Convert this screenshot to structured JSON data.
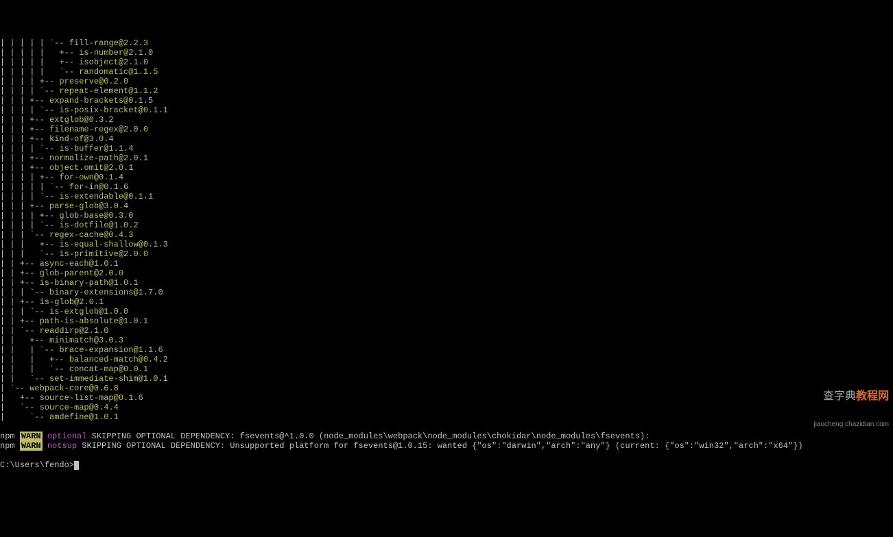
{
  "tree_lines": [
    {
      "prefix": "| | | | | `-- ",
      "pkg": "fill-range@2.2.3"
    },
    {
      "prefix": "| | | | |   +-- ",
      "pkg": "is-number@2.1.0"
    },
    {
      "prefix": "| | | | |   +-- ",
      "pkg": "isobject@2.1.0"
    },
    {
      "prefix": "| | | | |   `-- ",
      "pkg": "randomatic@1.1.5"
    },
    {
      "prefix": "| | | | +-- ",
      "pkg": "preserve@0.2.0"
    },
    {
      "prefix": "| | | | `-- ",
      "pkg": "repeat-element@1.1.2"
    },
    {
      "prefix": "| | | +-- ",
      "pkg": "expand-brackets@0.1.5"
    },
    {
      "prefix": "| | | | `-- ",
      "pkg": "is-posix-bracket@0.1.1"
    },
    {
      "prefix": "| | | +-- ",
      "pkg": "extglob@0.3.2"
    },
    {
      "prefix": "| | | +-- ",
      "pkg": "filename-regex@2.0.0"
    },
    {
      "prefix": "| | | +-- ",
      "pkg": "kind-of@3.0.4"
    },
    {
      "prefix": "| | | | `-- ",
      "pkg": "is-buffer@1.1.4"
    },
    {
      "prefix": "| | | +-- ",
      "pkg": "normalize-path@2.0.1"
    },
    {
      "prefix": "| | | +-- ",
      "pkg": "object.omit@2.0.1"
    },
    {
      "prefix": "| | | | +-- ",
      "pkg": "for-own@0.1.4"
    },
    {
      "prefix": "| | | | | `-- ",
      "pkg": "for-in@0.1.6"
    },
    {
      "prefix": "| | | | `-- ",
      "pkg": "is-extendable@0.1.1"
    },
    {
      "prefix": "| | | +-- ",
      "pkg": "parse-glob@3.0.4"
    },
    {
      "prefix": "| | | | +-- ",
      "pkg": "glob-base@0.3.0"
    },
    {
      "prefix": "| | | | `-- ",
      "pkg": "is-dotfile@1.0.2"
    },
    {
      "prefix": "| | | `-- ",
      "pkg": "regex-cache@0.4.3"
    },
    {
      "prefix": "| | |   +-- ",
      "pkg": "is-equal-shallow@0.1.3"
    },
    {
      "prefix": "| | |   `-- ",
      "pkg": "is-primitive@2.0.0"
    },
    {
      "prefix": "| | +-- ",
      "pkg": "async-each@1.0.1"
    },
    {
      "prefix": "| | +-- ",
      "pkg": "glob-parent@2.0.0"
    },
    {
      "prefix": "| | +-- ",
      "pkg": "is-binary-path@1.0.1"
    },
    {
      "prefix": "| | | `-- ",
      "pkg": "binary-extensions@1.7.0"
    },
    {
      "prefix": "| | +-- ",
      "pkg": "is-glob@2.0.1"
    },
    {
      "prefix": "| | | `-- ",
      "pkg": "is-extglob@1.0.0"
    },
    {
      "prefix": "| | +-- ",
      "pkg": "path-is-absolute@1.0.1"
    },
    {
      "prefix": "| | `-- ",
      "pkg": "readdirp@2.1.0"
    },
    {
      "prefix": "| |   +-- ",
      "pkg": "minimatch@3.0.3"
    },
    {
      "prefix": "| |   | `-- ",
      "pkg": "brace-expansion@1.1.6"
    },
    {
      "prefix": "| |   |   +-- ",
      "pkg": "balanced-match@0.4.2"
    },
    {
      "prefix": "| |   |   `-- ",
      "pkg": "concat-map@0.0.1"
    },
    {
      "prefix": "| |   `-- ",
      "pkg": "set-immediate-shim@1.0.1"
    },
    {
      "prefix": "| `-- ",
      "pkg": "webpack-core@0.6.8"
    },
    {
      "prefix": "|   +-- ",
      "pkg": "source-list-map@0.1.6"
    },
    {
      "prefix": "|   `-- ",
      "pkg": "source-map@0.4.4"
    },
    {
      "prefix": "|     `-- ",
      "pkg": "amdefine@1.0.1"
    }
  ],
  "blank_line": "",
  "warn1": {
    "npm": "npm",
    "warn": "WARN",
    "type": "optional",
    "msg": " SKIPPING OPTIONAL DEPENDENCY: fsevents@^1.0.0 (node_modules\\webpack\\node_modules\\chokidar\\node_modules\\fsevents):"
  },
  "warn2": {
    "npm": "npm",
    "warn": "WARN",
    "type": "notsup",
    "msg": " SKIPPING OPTIONAL DEPENDENCY: Unsupported platform for fsevents@1.0.15: wanted {\"os\":\"darwin\",\"arch\":\"any\"} (current: {\"os\":\"win32\",\"arch\":\"x64\"})"
  },
  "blank_line2": "",
  "prompt": "C:\\Users\\fendo>",
  "watermark": {
    "main1": "查字典",
    "main2": "教程网",
    "sub": "jiaocheng.chazidian.com"
  }
}
